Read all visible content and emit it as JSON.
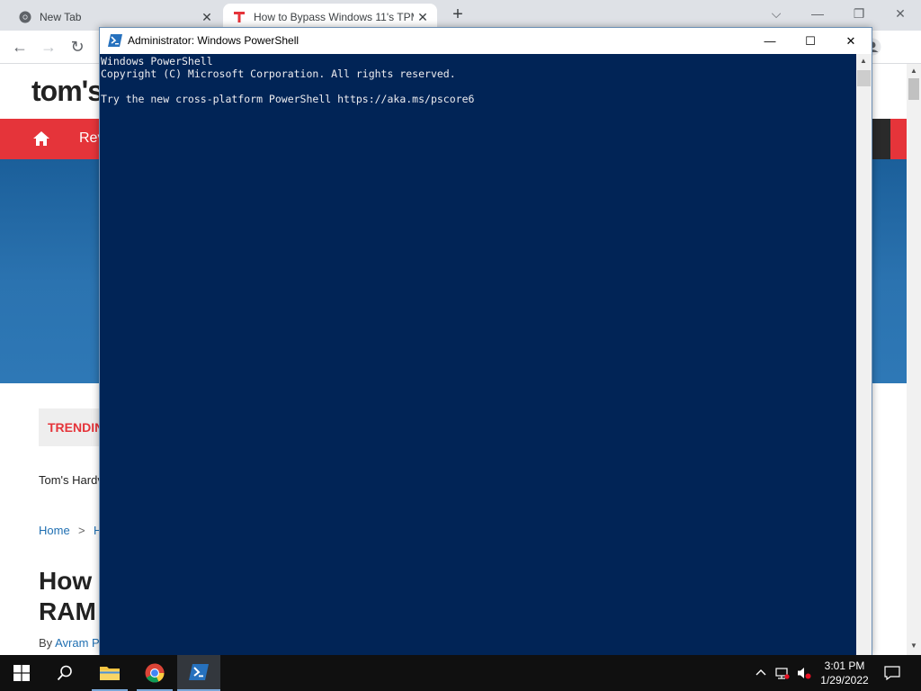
{
  "browser": {
    "tabs": [
      {
        "title": "New Tab",
        "active": false
      },
      {
        "title": "How to Bypass Windows 11's TPM",
        "active": true
      }
    ],
    "new_tab_glyph": "+",
    "window_controls": {
      "tab_search": "⌵",
      "minimize": "—",
      "restore": "❐",
      "close": "✕"
    },
    "nav": {
      "back": "←",
      "forward": "→",
      "reload": "↻"
    }
  },
  "page": {
    "logo": "tom's",
    "nav_items": [
      "Rev"
    ],
    "trending_label": "TRENDIN",
    "tagline": "Tom's Hardv",
    "breadcrumb": {
      "home": "Home",
      "separator": ">",
      "next": "H"
    },
    "headline_line1": "How",
    "headline_line2": "RAM",
    "byline_prefix": "By",
    "byline_author": "Avram P"
  },
  "powershell": {
    "title": "Administrator: Windows PowerShell",
    "controls": {
      "minimize": "—",
      "maximize": "☐",
      "close": "✕"
    },
    "lines": [
      "Windows PowerShell",
      "Copyright (C) Microsoft Corporation. All rights reserved.",
      "",
      "Try the new cross-platform PowerShell https://aka.ms/pscore6"
    ],
    "colors": {
      "background": "#012456",
      "foreground": "#eeedf0"
    }
  },
  "taskbar": {
    "apps": [
      "start-icon",
      "search-icon",
      "file-explorer-icon",
      "chrome-icon",
      "powershell-icon"
    ],
    "tray": {
      "chevron": "^",
      "time": "3:01 PM",
      "date": "1/29/2022"
    }
  },
  "colors": {
    "accent_red": "#e5343a",
    "link_blue": "#1f6fb2"
  }
}
